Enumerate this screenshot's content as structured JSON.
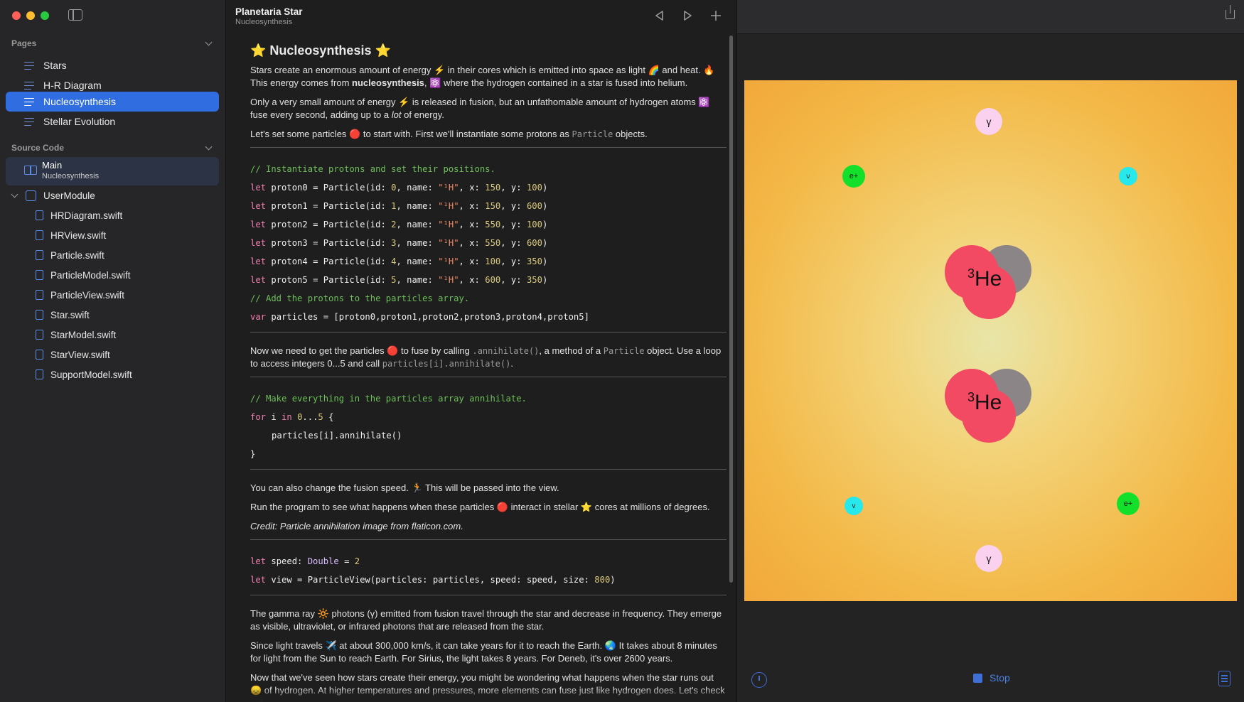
{
  "window": {
    "traffic_colors": [
      "#ff5f57",
      "#febc2e",
      "#28c840"
    ]
  },
  "sidebar": {
    "pages_header": "Pages",
    "pages": [
      {
        "label": "Stars"
      },
      {
        "label": "H-R Diagram"
      },
      {
        "label": "Nucleosynthesis",
        "selected": true
      },
      {
        "label": "Stellar Evolution"
      }
    ],
    "source_header": "Source Code",
    "main": {
      "title": "Main",
      "subtitle": "Nucleosynthesis"
    },
    "module": {
      "label": "UserModule"
    },
    "files": [
      "HRDiagram.swift",
      "HRView.swift",
      "Particle.swift",
      "ParticleModel.swift",
      "ParticleView.swift",
      "Star.swift",
      "StarModel.swift",
      "StarView.swift",
      "SupportModel.swift"
    ]
  },
  "editor": {
    "title": "Planetaria Star",
    "subtitle": "Nucleosynthesis",
    "heading": "⭐ Nucleosynthesis ⭐",
    "p1a": "Stars create an enormous amount of energy ⚡ in their cores which is emitted into space as light 🌈 and heat. 🔥",
    "p1b_pre": "This energy comes from ",
    "p1b_bold": "nucleosynthesis",
    "p1b_post": ", ⚛️ where the hydrogen contained in a star is fused into helium.",
    "p2_pre": "Only a very small amount of energy ⚡ is released in fusion, but an unfathomable amount of hydrogen atoms ⚛️ fuse every second, adding up to a ",
    "p2_em": "lot",
    "p2_post": " of energy.",
    "p3_pre": "Let's set some particles 🔴 to start with. First we'll instantiate some protons as ",
    "p3_code": "Particle",
    "p3_post": " objects.",
    "code1_comment": "// Instantiate protons and set their positions.",
    "protons": [
      {
        "name": "proton0",
        "id": "0",
        "x": "150",
        "y": "100"
      },
      {
        "name": "proton1",
        "id": "1",
        "x": "150",
        "y": "600"
      },
      {
        "name": "proton2",
        "id": "2",
        "x": "550",
        "y": "100"
      },
      {
        "name": "proton3",
        "id": "3",
        "x": "550",
        "y": "600"
      },
      {
        "name": "proton4",
        "id": "4",
        "x": "100",
        "y": "350"
      },
      {
        "name": "proton5",
        "id": "5",
        "x": "600",
        "y": "350"
      }
    ],
    "proton_symbol": "\"¹H\"",
    "code1_comment2": "// Add the protons to the particles array.",
    "code1_array": "particles = [proton0,proton1,proton2,proton3,proton4,proton5]",
    "p4_pre": "Now we need to get the particles 🔴 to fuse by calling ",
    "p4_code1": ".annihilate()",
    "p4_mid": ", a method of a ",
    "p4_code2": "Particle",
    "p4_mid2": " object. Use a loop to access integers 0...5 and call ",
    "p4_code3": "particles[i].annihilate()",
    "p4_post": ".",
    "code2_comment": "// Make everything in the particles array annihilate.",
    "code2_body": "particles[i].annihilate()",
    "p5": "You can also change the fusion speed. 🏃 This will be passed into the view.",
    "p6": "Run the program to see what happens when these particles 🔴 interact in stellar ⭐ cores at millions of degrees.",
    "p7": "Credit: Particle annihilation image from flaticon.com.",
    "speed_value": "2",
    "view_size": "800",
    "p8": "The gamma ray 🔆 photons (γ) emitted from fusion travel through the star and decrease in frequency. They emerge as visible, ultraviolet, or infrared photons that are released from the star.",
    "p9": "Since light travels ✈️ at about 300,000 km/s, it can take years for it to reach the Earth. 🌏 It takes about 8 minutes for light from the Sun to reach Earth. For Sirius, the light takes 8 years. For Deneb, it's over 2600 years.",
    "p10": "Now that we've seen how stars create their energy, you might be wondering what happens when the star runs out 😞 of hydrogen. At higher temperatures and pressures, more elements can fuse just like hydrogen does. Let's check out"
  },
  "preview": {
    "gamma": "γ",
    "positron": "e+",
    "neutrino": "ν",
    "helium_mass": "3",
    "helium_symbol": "He",
    "stop_label": "Stop"
  }
}
